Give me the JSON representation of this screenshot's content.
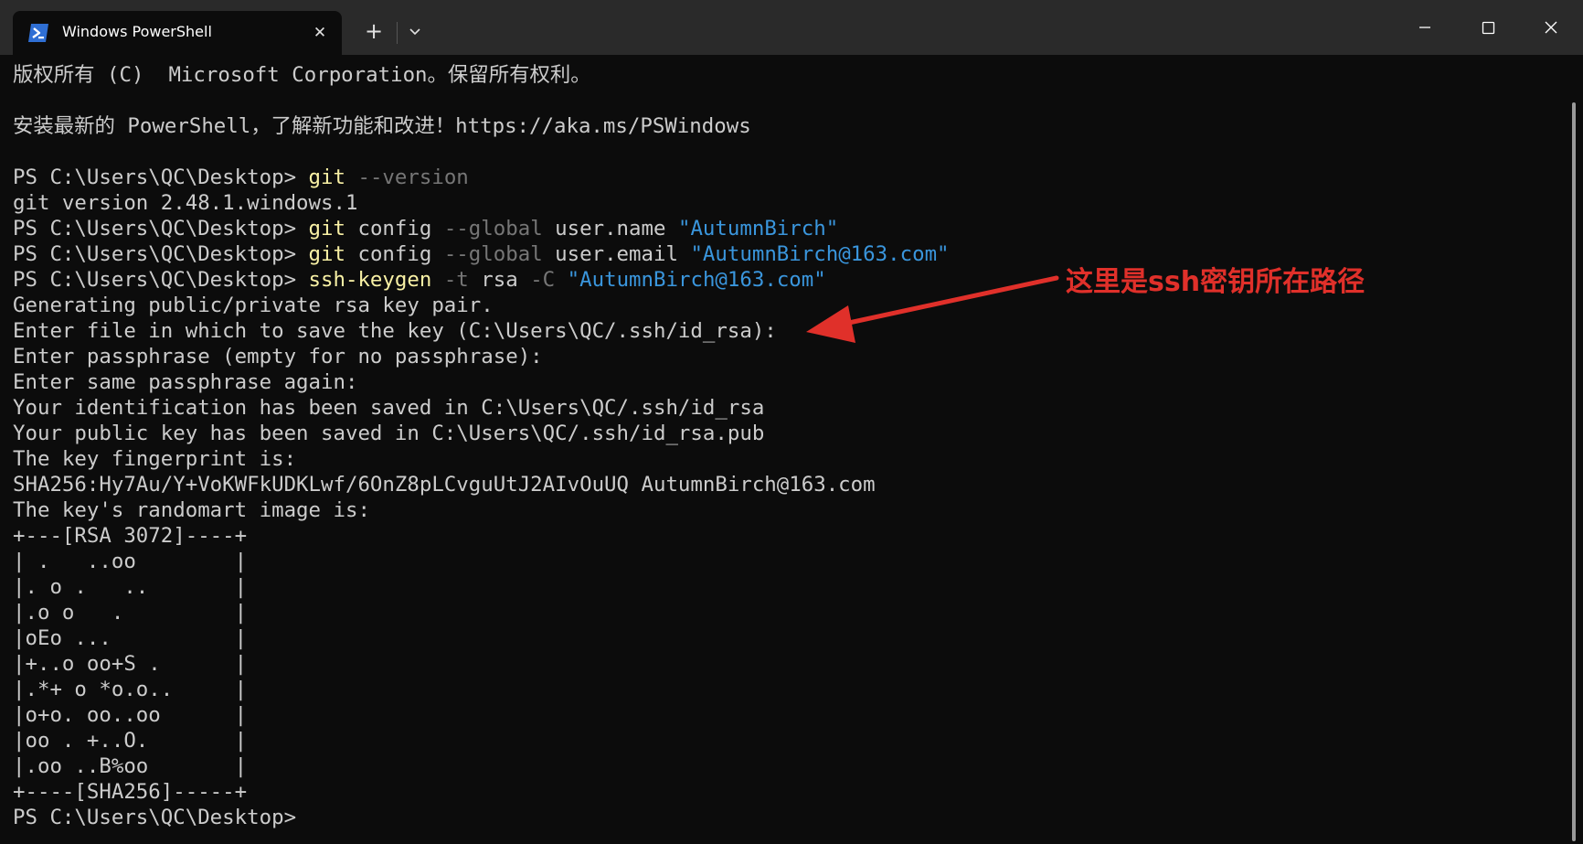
{
  "window": {
    "tab_title": "Windows PowerShell",
    "tab_icon": "powershell-icon",
    "new_tab_glyph": "+",
    "close_tab_glyph": "✕"
  },
  "colors": {
    "background": "#0c0c0c",
    "titlebar": "#2a2a2a",
    "text": "#cccccc",
    "command": "#f9f1a5",
    "parameter": "#767676",
    "string": "#3a96dd",
    "annotation": "#e0302a"
  },
  "terminal": {
    "lines": [
      [
        {
          "t": "版权所有 (C)  Microsoft Corporation。保留所有权利。",
          "c": "plain"
        }
      ],
      [
        {
          "t": "",
          "c": "plain"
        }
      ],
      [
        {
          "t": "安装最新的 PowerShell，了解新功能和改进！https://aka.ms/PSWindows",
          "c": "plain"
        }
      ],
      [
        {
          "t": "",
          "c": "plain"
        }
      ],
      [
        {
          "t": "PS C:\\Users\\QC\\Desktop> ",
          "c": "plain"
        },
        {
          "t": "git",
          "c": "cmd"
        },
        {
          "t": " --version",
          "c": "param"
        }
      ],
      [
        {
          "t": "git version 2.48.1.windows.1",
          "c": "plain"
        }
      ],
      [
        {
          "t": "PS C:\\Users\\QC\\Desktop> ",
          "c": "plain"
        },
        {
          "t": "git",
          "c": "cmd"
        },
        {
          "t": " config ",
          "c": "plain"
        },
        {
          "t": "--global",
          "c": "param"
        },
        {
          "t": " user.name ",
          "c": "plain"
        },
        {
          "t": "\"AutumnBirch\"",
          "c": "string"
        }
      ],
      [
        {
          "t": "PS C:\\Users\\QC\\Desktop> ",
          "c": "plain"
        },
        {
          "t": "git",
          "c": "cmd"
        },
        {
          "t": " config ",
          "c": "plain"
        },
        {
          "t": "--global",
          "c": "param"
        },
        {
          "t": " user.email ",
          "c": "plain"
        },
        {
          "t": "\"AutumnBirch@163.com\"",
          "c": "string"
        }
      ],
      [
        {
          "t": "PS C:\\Users\\QC\\Desktop> ",
          "c": "plain"
        },
        {
          "t": "ssh-keygen",
          "c": "cmd"
        },
        {
          "t": " -t",
          "c": "param"
        },
        {
          "t": " rsa ",
          "c": "plain"
        },
        {
          "t": "-C",
          "c": "param"
        },
        {
          "t": " ",
          "c": "plain"
        },
        {
          "t": "\"AutumnBirch@163.com\"",
          "c": "string"
        }
      ],
      [
        {
          "t": "Generating public/private rsa key pair.",
          "c": "plain"
        }
      ],
      [
        {
          "t": "Enter file in which to save the key (C:\\Users\\QC/.ssh/id_rsa):",
          "c": "plain"
        }
      ],
      [
        {
          "t": "Enter passphrase (empty for no passphrase):",
          "c": "plain"
        }
      ],
      [
        {
          "t": "Enter same passphrase again:",
          "c": "plain"
        }
      ],
      [
        {
          "t": "Your identification has been saved in C:\\Users\\QC/.ssh/id_rsa",
          "c": "plain"
        }
      ],
      [
        {
          "t": "Your public key has been saved in C:\\Users\\QC/.ssh/id_rsa.pub",
          "c": "plain"
        }
      ],
      [
        {
          "t": "The key fingerprint is:",
          "c": "plain"
        }
      ],
      [
        {
          "t": "SHA256:Hy7Au/Y+VoKWFkUDKLwf/6OnZ8pLCvguUtJ2AIvOuUQ AutumnBirch@163.com",
          "c": "plain"
        }
      ],
      [
        {
          "t": "The key's randomart image is:",
          "c": "plain"
        }
      ],
      [
        {
          "t": "+---[RSA 3072]----+",
          "c": "plain"
        }
      ],
      [
        {
          "t": "| .   ..oo        |",
          "c": "plain"
        }
      ],
      [
        {
          "t": "|. o .   ..       |",
          "c": "plain"
        }
      ],
      [
        {
          "t": "|.o o   .         |",
          "c": "plain"
        }
      ],
      [
        {
          "t": "|oEo ...          |",
          "c": "plain"
        }
      ],
      [
        {
          "t": "|+..o oo+S .      |",
          "c": "plain"
        }
      ],
      [
        {
          "t": "|.*+ o *o.o..     |",
          "c": "plain"
        }
      ],
      [
        {
          "t": "|o+o. oo..oo      |",
          "c": "plain"
        }
      ],
      [
        {
          "t": "|oo . +..O.       |",
          "c": "plain"
        }
      ],
      [
        {
          "t": "|.oo ..B%oo       |",
          "c": "plain"
        }
      ],
      [
        {
          "t": "+----[SHA256]-----+",
          "c": "plain"
        }
      ],
      [
        {
          "t": "PS C:\\Users\\QC\\Desktop>",
          "c": "plain"
        }
      ]
    ]
  },
  "annotation": {
    "text": "这里是ssh密钥所在路径",
    "icon": "red-arrow-icon"
  }
}
